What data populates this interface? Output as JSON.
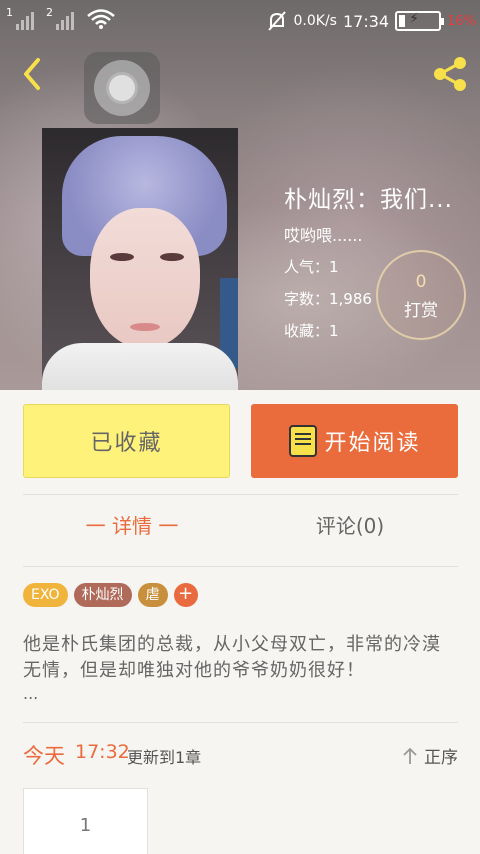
{
  "status_bar": {
    "sim1": "1",
    "sim2": "2",
    "net_speed": "0.0K/s",
    "time": "17:34",
    "battery_percent": "16%",
    "battery_level": 0.16
  },
  "book": {
    "title": "朴灿烈：我们...",
    "subtitle": "哎哟喂......",
    "popularity": "人气：1",
    "word_count": "字数：1,986",
    "favorites": "收藏：1"
  },
  "reward": {
    "count": "0",
    "label": "打赏"
  },
  "actions": {
    "collected_label": "已收藏",
    "read_label": "开始阅读"
  },
  "tabs": {
    "detail": "一 详情 一",
    "comment": "评论(0)"
  },
  "tags": [
    {
      "label": "EXO",
      "color": "#f0b43c"
    },
    {
      "label": "朴灿烈",
      "color": "#b06a5a"
    },
    {
      "label": "虐",
      "color": "#c8903c"
    }
  ],
  "tag_add": "+",
  "description": "他是朴氏集团的总裁，从小父母双亡，非常的冷漠无情，但是却唯独对他的爷爷奶奶很好！",
  "description_more": "...",
  "update": {
    "today": "今天",
    "time": "17:32",
    "text": "更新到1章"
  },
  "sort_label": "正序",
  "chapters": [
    "1"
  ],
  "colors": {
    "accent": "#ea6b3c",
    "collected_bg": "#fff27a"
  }
}
